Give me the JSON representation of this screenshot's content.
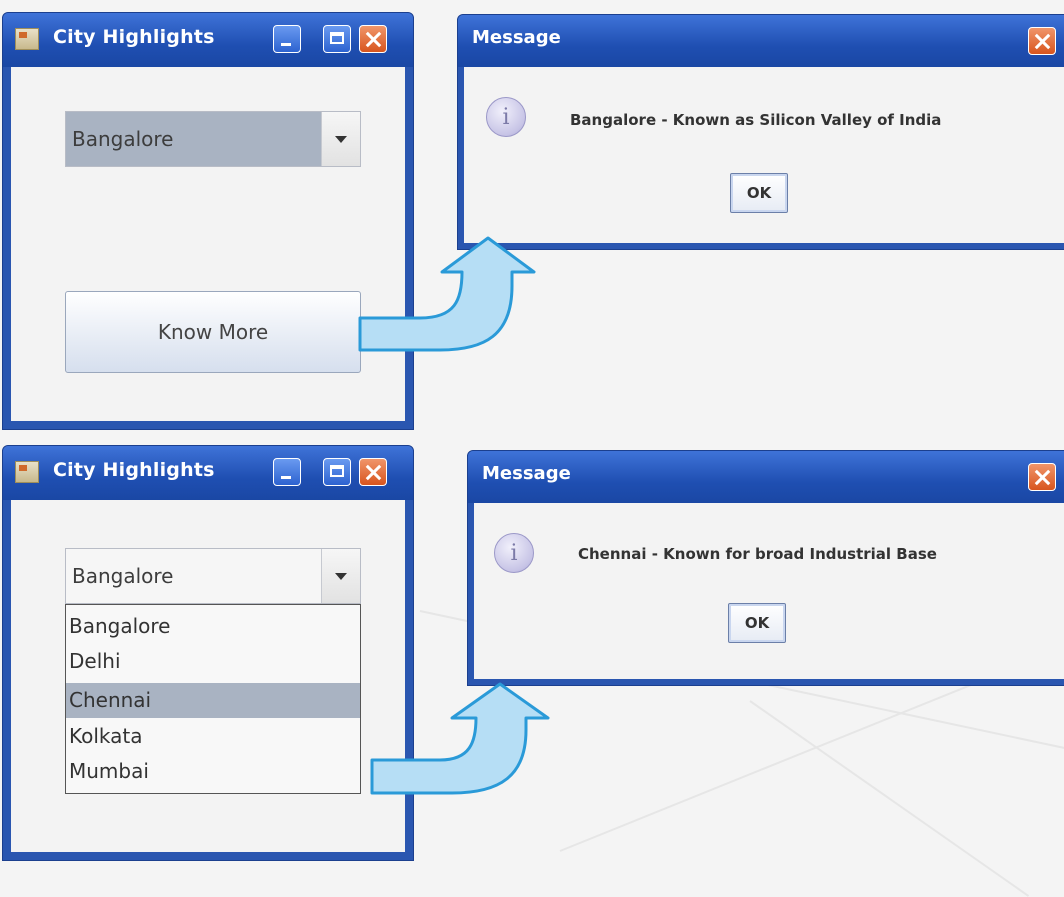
{
  "top_panel": {
    "main_window": {
      "title": "City Highlights",
      "combo_value": "Bangalore",
      "button_label": "Know More"
    },
    "dialog": {
      "title": "Message",
      "message": "Bangalore - Known as Silicon Valley of India",
      "ok_label": "OK"
    }
  },
  "bottom_panel": {
    "main_window": {
      "title": "City Highlights",
      "combo_value": "Bangalore",
      "options": [
        "Bangalore",
        "Delhi",
        "Chennai",
        "Kolkata",
        "Mumbai"
      ],
      "highlighted_option": "Chennai"
    },
    "dialog": {
      "title": "Message",
      "message": "Chennai - Known for broad Industrial Base",
      "ok_label": "OK"
    }
  },
  "colors": {
    "title_bar": "#2a56b0",
    "selection": "#a9b3c2",
    "arrow_fill": "#b6def5",
    "arrow_stroke": "#2a9ad8"
  },
  "icons": [
    "app-icon",
    "minimize-icon",
    "maximize-icon",
    "close-icon",
    "info-icon",
    "curved-arrow-icon"
  ]
}
